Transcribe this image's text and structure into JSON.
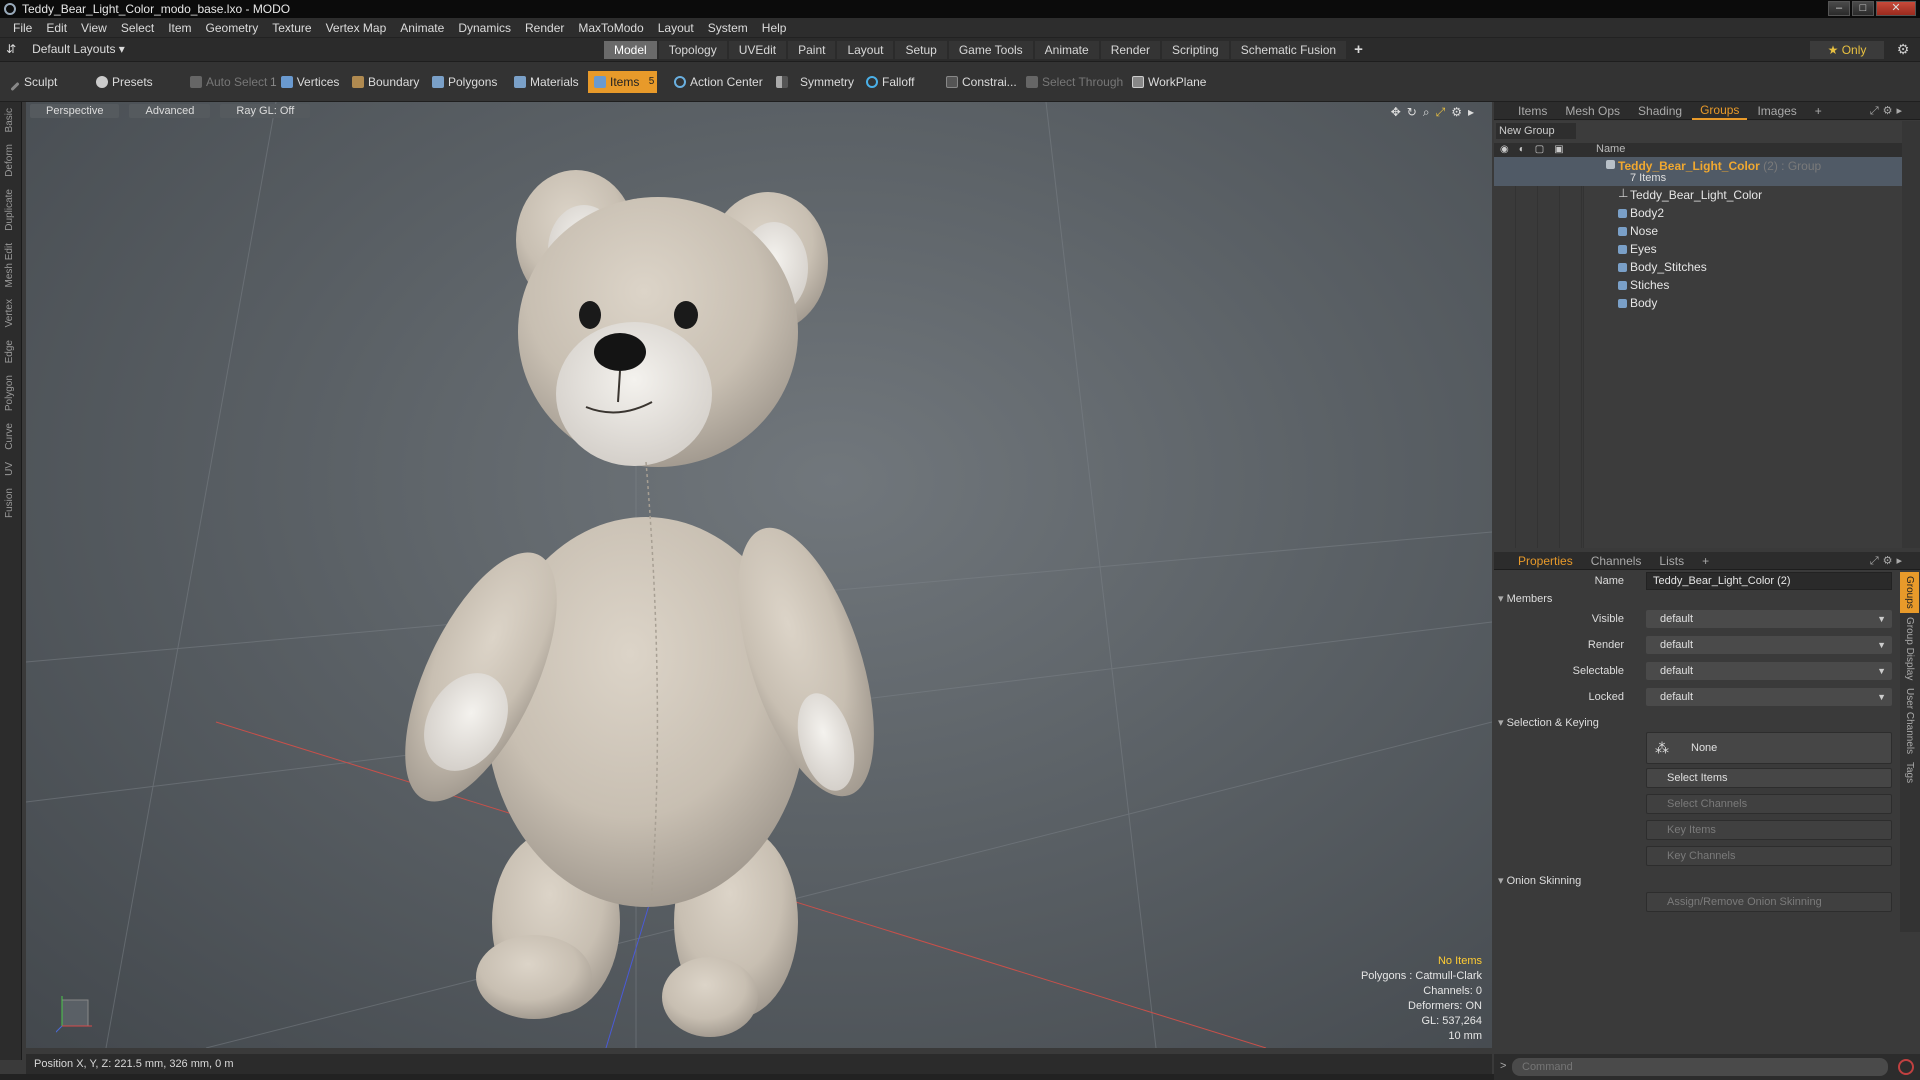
{
  "window": {
    "title": "Teddy_Bear_Light_Color_modo_base.lxo - MODO",
    "controls": [
      "–",
      "□",
      "✕"
    ]
  },
  "menu": [
    "File",
    "Edit",
    "View",
    "Select",
    "Item",
    "Geometry",
    "Texture",
    "Vertex Map",
    "Animate",
    "Dynamics",
    "Render",
    "MaxToModo",
    "Layout",
    "System",
    "Help"
  ],
  "layoutbar": {
    "layouts_label": "Default Layouts",
    "mode_tabs": [
      "Model",
      "Topology",
      "UVEdit",
      "Paint",
      "Layout",
      "Setup",
      "Game Tools",
      "Animate",
      "Render",
      "Scripting",
      "Schematic Fusion"
    ],
    "active_tab": "Model",
    "add_tab": "+",
    "only_label": "Only"
  },
  "toolbar": {
    "sculpt": "Sculpt",
    "presets": "Presets",
    "auto_select": "Auto Select",
    "vertices": "Vertices",
    "vertices_count": "1",
    "boundary": "Boundary",
    "polygons": "Polygons",
    "materials": "Materials",
    "items": "Items",
    "items_count": "5",
    "action_center": "Action Center",
    "symmetry": "Symmetry",
    "falloff": "Falloff",
    "constraints": "Constrai...",
    "select_through": "Select Through",
    "workplane": "WorkPlane"
  },
  "left_strip": [
    "Basic",
    "Deform",
    "Duplicate",
    "Mesh Edit",
    "Vertex",
    "Edge",
    "Polygon",
    "Curve",
    "UV",
    "Fusion"
  ],
  "viewport": {
    "view_mode": "Perspective",
    "shading": "Advanced",
    "raygl": "Ray GL: Off",
    "info": {
      "selection": "No Items",
      "polygons": "Polygons : Catmull-Clark",
      "channels": "Channels: 0",
      "deformers": "Deformers: ON",
      "gl": "GL: 537,264",
      "scale": "10 mm"
    }
  },
  "statusbar": {
    "position": "Position X, Y, Z:  221.5 mm, 326 mm, 0 m"
  },
  "top_panel": {
    "tabs": [
      "Items",
      "Mesh Ops",
      "Shading",
      "Groups",
      "Images"
    ],
    "active_tab": "Groups",
    "add_tab": "+",
    "new_group": "New Group",
    "name_col": "Name",
    "group": {
      "name": "Teddy_Bear_Light_Color",
      "suffix": " (2) : Group",
      "count": "7 Items"
    },
    "members": [
      "Teddy_Bear_Light_Color",
      "Body2",
      "Nose",
      "Eyes",
      "Body_Stitches",
      "Stiches",
      "Body"
    ]
  },
  "properties": {
    "tabs": [
      "Properties",
      "Channels",
      "Lists"
    ],
    "active_tab": "Properties",
    "add_tab": "+",
    "name_label": "Name",
    "name_value": "Teddy_Bear_Light_Color (2)",
    "members_section": "Members",
    "visible_label": "Visible",
    "visible_value": "default",
    "render_label": "Render",
    "render_value": "default",
    "selectable_label": "Selectable",
    "selectable_value": "default",
    "locked_label": "Locked",
    "locked_value": "default",
    "selection_section": "Selection & Keying",
    "none_btn": "None",
    "select_items": "Select Items",
    "select_channels": "Select Channels",
    "key_items": "Key Items",
    "key_channels": "Key Channels",
    "onion_section": "Onion Skinning",
    "onion_btn": "Assign/Remove Onion Skinning",
    "side_tabs": [
      "Groups",
      "Group Display",
      "User Channels",
      "Tags"
    ]
  },
  "command": {
    "prompt": ">",
    "placeholder": "Command"
  },
  "colors": {
    "accent": "#e89a2a",
    "group_name": "#f0a830",
    "info_highlight": "#ffcc33"
  }
}
